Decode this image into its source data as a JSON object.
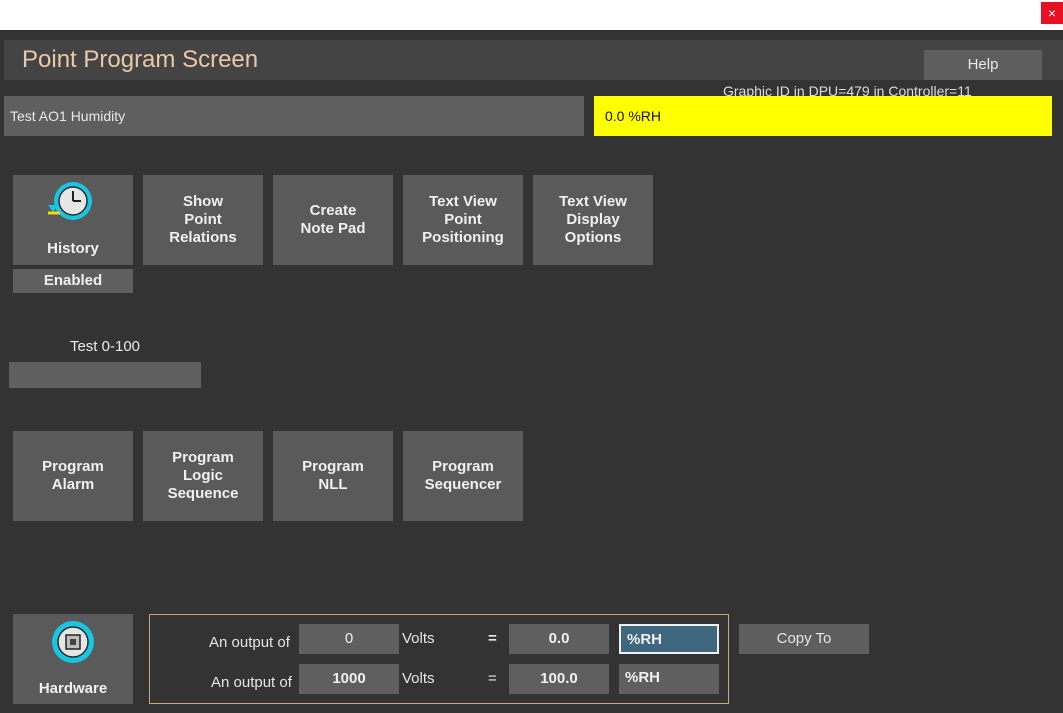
{
  "window": {
    "close_symbol": "×"
  },
  "header": {
    "title": "Point Program Screen",
    "help_label": "Help",
    "graphic_id": "Graphic ID in DPU=479 in Controller=11"
  },
  "point": {
    "name": "Test AO1 Humidity",
    "value": "0.0 %RH"
  },
  "actions_row1": {
    "history": {
      "label": "History",
      "status": "Enabled",
      "icon": "history-clock-icon"
    },
    "show_relations": [
      "Show",
      "Point",
      "Relations"
    ],
    "create_note": [
      "Create",
      "Note Pad"
    ],
    "text_view_positioning": [
      "Text View",
      "Point",
      "Positioning"
    ],
    "text_view_display": [
      "Text View",
      "Display",
      "Options"
    ]
  },
  "range": {
    "label": "Test 0-100"
  },
  "actions_row2": {
    "program_alarm": [
      "Program",
      "Alarm"
    ],
    "program_logic": [
      "Program",
      "Logic",
      "Sequence"
    ],
    "program_nll": [
      "Program",
      "NLL"
    ],
    "program_sequencer": [
      "Program",
      "Sequencer"
    ]
  },
  "hardware": {
    "label": "Hardware",
    "icon": "hardware-chip-icon"
  },
  "scaling": {
    "rows": [
      {
        "label": "An output of",
        "raw": "0",
        "raw_unit": "Volts",
        "eq": "=",
        "eng": "0.0",
        "eng_unit": "%RH"
      },
      {
        "label": "An output of",
        "raw": "1000",
        "raw_unit": "Volts",
        "eq": "=",
        "eng": "100.0",
        "eng_unit": "%RH"
      }
    ],
    "copy_label": "Copy To"
  },
  "colors": {
    "background": "#333333",
    "tile": "#5a5a5a",
    "value_highlight": "#ffff00",
    "title_accent": "#e8c9a8",
    "icon_accent": "#19c5e3",
    "box_border": "#c8a77e"
  }
}
